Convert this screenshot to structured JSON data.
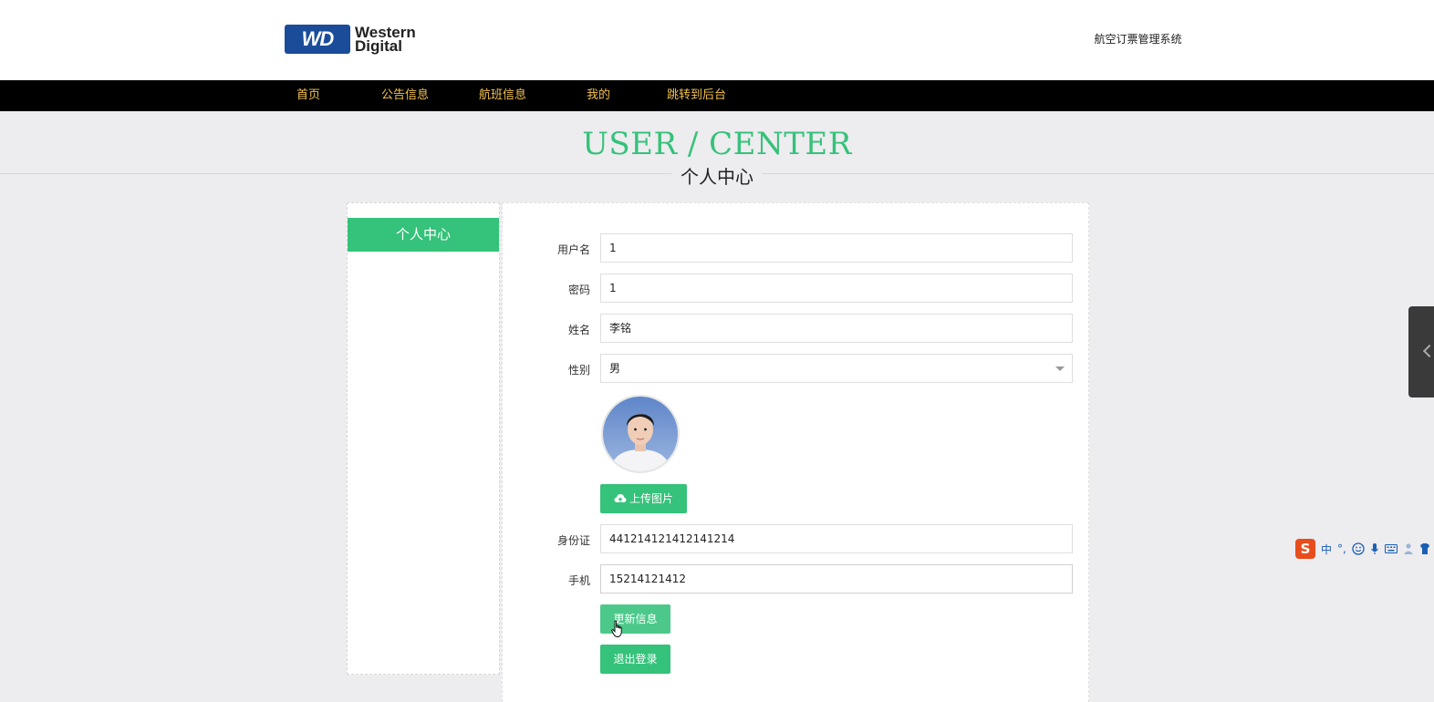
{
  "header": {
    "logo": {
      "mark": "WD",
      "line1": "Western",
      "line2": "Digital"
    },
    "site_title": "航空订票管理系统"
  },
  "nav": {
    "items": [
      "首页",
      "公告信息",
      "航班信息",
      "我的",
      "跳转到后台"
    ]
  },
  "heading": {
    "en": "USER / CENTER",
    "cn": "个人中心"
  },
  "sidebar": {
    "items": [
      {
        "label": "个人中心",
        "active": true
      }
    ]
  },
  "form": {
    "username": {
      "label": "用户名",
      "value": "1"
    },
    "password": {
      "label": "密码",
      "value": "1"
    },
    "name": {
      "label": "姓名",
      "value": "李铭"
    },
    "gender": {
      "label": "性别",
      "value": "男"
    },
    "id_card": {
      "label": "身份证",
      "value": "441214121412141214"
    },
    "phone": {
      "label": "手机",
      "value": "15214121412"
    },
    "upload_button": "上传图片",
    "update_button": "更新信息",
    "logout_button": "退出登录"
  },
  "ime": {
    "logo": "S",
    "mode": "中",
    "punct": "°,"
  },
  "colors": {
    "accent": "#35c27a",
    "nav_bg": "#000000",
    "nav_text": "#f3c24d",
    "page_bg": "#edecef"
  }
}
